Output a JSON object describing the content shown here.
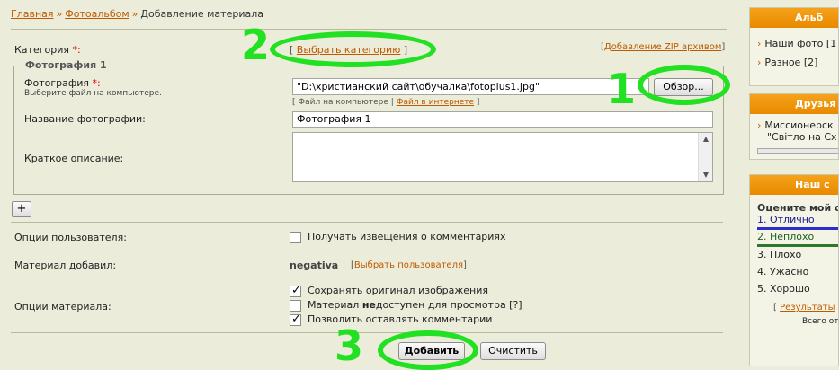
{
  "breadcrumb": {
    "home": "Главная",
    "album": "Фотоальбом",
    "current": "Добавление материала",
    "sep": "»"
  },
  "category": {
    "label": "Категория",
    "required": "*:",
    "select_link": "Выбрать категорию",
    "zip_link": "Добавление ZIP архивом"
  },
  "photo": {
    "legend": "Фотография 1",
    "file_label": "Фотография",
    "file_required": "*:",
    "file_hint": "Выберите файл на компьютере.",
    "file_value": "\"D:\\христианский сайт\\обучалка\\fotoplus1.jpg\"",
    "browse_label": "Обзор...",
    "source_computer": "Файл на компьютере",
    "source_sep": "|",
    "source_internet": "Файл в интернете",
    "title_label": "Название фотографии:",
    "title_value": "Фотография 1",
    "desc_label": "Краткое описание:",
    "desc_value": ""
  },
  "add_photo_button": "+",
  "user_options": {
    "label": "Опции пользователя:",
    "notify": "Получать извещения о комментариях",
    "notify_checked": false
  },
  "author": {
    "label": "Материал добавил:",
    "name": "negativa",
    "select_user": "Выбрать пользователя"
  },
  "material_options": {
    "label": "Опции материала:",
    "items": [
      {
        "text": "Сохранять оригинал изображения",
        "checked": true
      },
      {
        "text_pre": "Материал ",
        "text_bold": "не",
        "text_post": "доступен для просмотра [?]",
        "checked": false
      },
      {
        "text": "Позволить оставлять комментарии",
        "checked": true
      }
    ]
  },
  "actions": {
    "submit": "Добавить",
    "reset": "Очистить"
  },
  "annotations": {
    "one": "1",
    "two": "2",
    "three": "3",
    "color": "#22e022"
  },
  "sidebar": {
    "album_title": "Альб",
    "album_items": [
      "Наши фото [1",
      "Разное [2]"
    ],
    "friends_title": "Друзья",
    "friends_item_line1": "Миссионерск",
    "friends_item_line2": "\"Світло на Сх",
    "poll_title": "Наш с",
    "poll_question": "Оцените мой са",
    "poll_options": [
      "1. Отлично",
      "2. Неплохо",
      "3. Плохо",
      "4. Ужасно",
      "5. Хорошо"
    ],
    "poll_results": "Результаты",
    "poll_total": "Всего отв"
  },
  "colors": {
    "link": "#c05a00",
    "header_orange": "#f0960e",
    "page_bg": "#ebecd9",
    "poll_bar_blue": "#2d2dc8",
    "poll_bar_green": "#2a7a2a"
  }
}
